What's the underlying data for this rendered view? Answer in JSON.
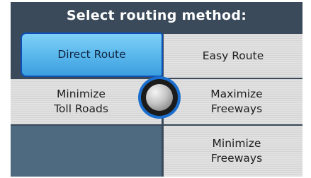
{
  "title": "Select routing method:",
  "buttons": {
    "direct_route": "Direct Route",
    "easy_route": "Easy Route",
    "minimize_toll_roads": "Minimize\nToll Roads",
    "maximize_freeways": "Maximize\nFreeways",
    "minimize_freeways": "Minimize\nFreeways"
  },
  "selected": "Direct Route",
  "colors": {
    "background": "#3a4a5a",
    "selected_fill": "#5ab8ec",
    "selected_border": "#0d4fb7",
    "option_fill": "#dddddd",
    "knob_ring": "#1b6fce"
  },
  "icons": {
    "center_knob": "joystick-knob-icon"
  }
}
